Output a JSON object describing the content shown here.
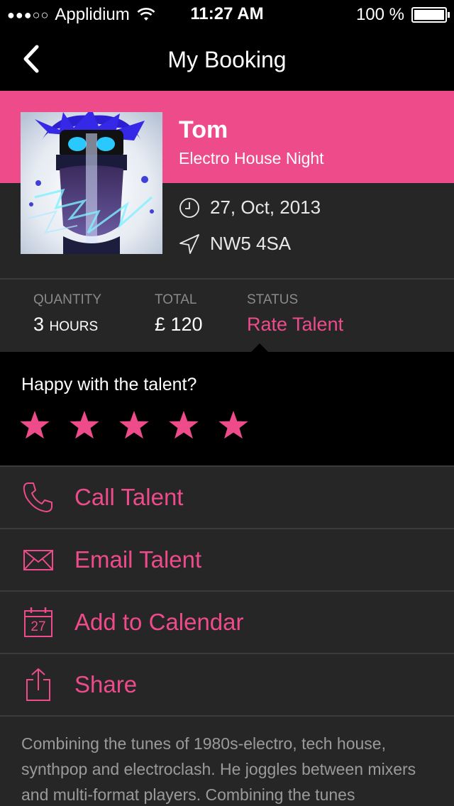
{
  "status_bar": {
    "signal": "●●●○○",
    "carrier": "Applidium",
    "time": "11:27 AM",
    "battery": "100 %"
  },
  "nav": {
    "title": "My Booking"
  },
  "booking": {
    "name": "Tom",
    "event": "Electro House Night",
    "date": "27, Oct, 2013",
    "location": "NW5 4SA"
  },
  "stats": {
    "quantity_label": "QUANTITY",
    "quantity_value": "3",
    "quantity_unit": "HOURS",
    "total_label": "TOTAL",
    "total_value": "£ 120",
    "status_label": "STATUS",
    "status_value": "Rate Talent"
  },
  "rating": {
    "question": "Happy with the talent?",
    "stars": 5,
    "max_stars": 5
  },
  "actions": [
    {
      "label": "Call Talent",
      "icon": "phone-icon"
    },
    {
      "label": "Email Talent",
      "icon": "envelope-icon"
    },
    {
      "label": "Add to Calendar",
      "icon": "calendar-icon",
      "icon_text": "27"
    },
    {
      "label": "Share",
      "icon": "share-icon"
    }
  ],
  "description": "Combining the tunes of 1980s-electro, tech house, synthpop and electroclash. He joggles between mixers and multi-format players. Combining the tunes",
  "colors": {
    "accent": "#ee4b8b",
    "background": "#262626",
    "bar": "#000000"
  }
}
